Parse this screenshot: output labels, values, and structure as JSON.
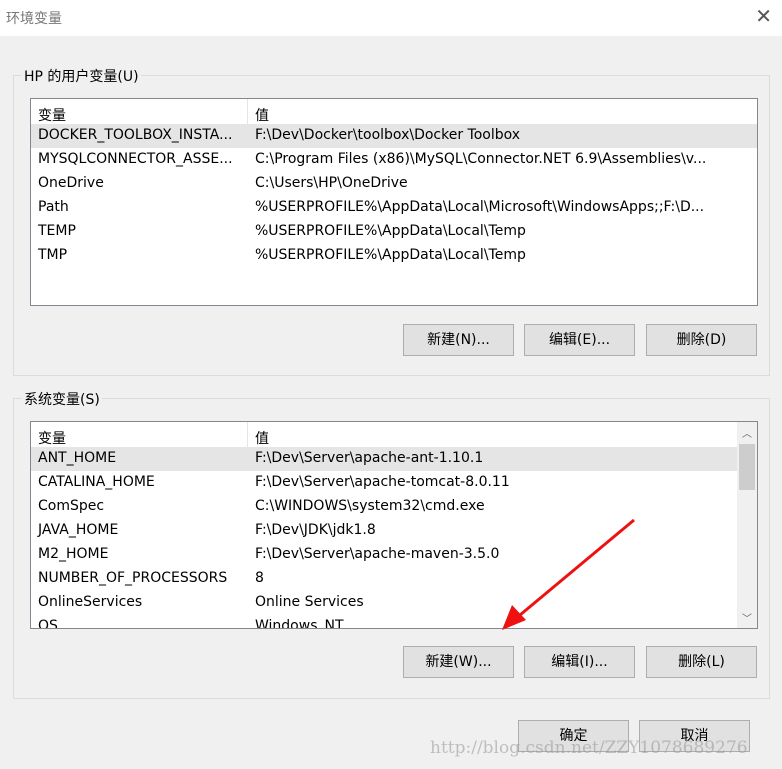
{
  "window": {
    "title": "环境变量",
    "close": "✕"
  },
  "user_vars": {
    "label": "HP 的用户变量(U)",
    "headers": [
      "变量",
      "值"
    ],
    "rows": [
      [
        "DOCKER_TOOLBOX_INSTA...",
        "F:\\Dev\\Docker\\toolbox\\Docker Toolbox"
      ],
      [
        "MYSQLCONNECTOR_ASSE...",
        "C:\\Program Files (x86)\\MySQL\\Connector.NET 6.9\\Assemblies\\v..."
      ],
      [
        "OneDrive",
        "C:\\Users\\HP\\OneDrive"
      ],
      [
        "Path",
        "%USERPROFILE%\\AppData\\Local\\Microsoft\\WindowsApps;;F:\\D..."
      ],
      [
        "TEMP",
        "%USERPROFILE%\\AppData\\Local\\Temp"
      ],
      [
        "TMP",
        "%USERPROFILE%\\AppData\\Local\\Temp"
      ]
    ],
    "buttons": {
      "new": "新建(N)...",
      "edit": "编辑(E)...",
      "delete": "删除(D)"
    }
  },
  "sys_vars": {
    "label": "系统变量(S)",
    "headers": [
      "变量",
      "值"
    ],
    "rows": [
      [
        "ANT_HOME",
        "F:\\Dev\\Server\\apache-ant-1.10.1"
      ],
      [
        "CATALINA_HOME",
        "F:\\Dev\\Server\\apache-tomcat-8.0.11"
      ],
      [
        "ComSpec",
        "C:\\WINDOWS\\system32\\cmd.exe"
      ],
      [
        "JAVA_HOME",
        "F:\\Dev\\JDK\\jdk1.8"
      ],
      [
        "M2_HOME",
        "F:\\Dev\\Server\\apache-maven-3.5.0"
      ],
      [
        "NUMBER_OF_PROCESSORS",
        "8"
      ],
      [
        "OnlineServices",
        "Online Services"
      ],
      [
        "OS",
        "Windows_NT"
      ]
    ],
    "buttons": {
      "new": "新建(W)...",
      "edit": "编辑(I)...",
      "delete": "删除(L)"
    }
  },
  "footer": {
    "ok": "确定",
    "cancel": "取消"
  },
  "watermark": "http://blog.csdn.net/ZZY1078689276",
  "annotation_color": "#ee1111"
}
